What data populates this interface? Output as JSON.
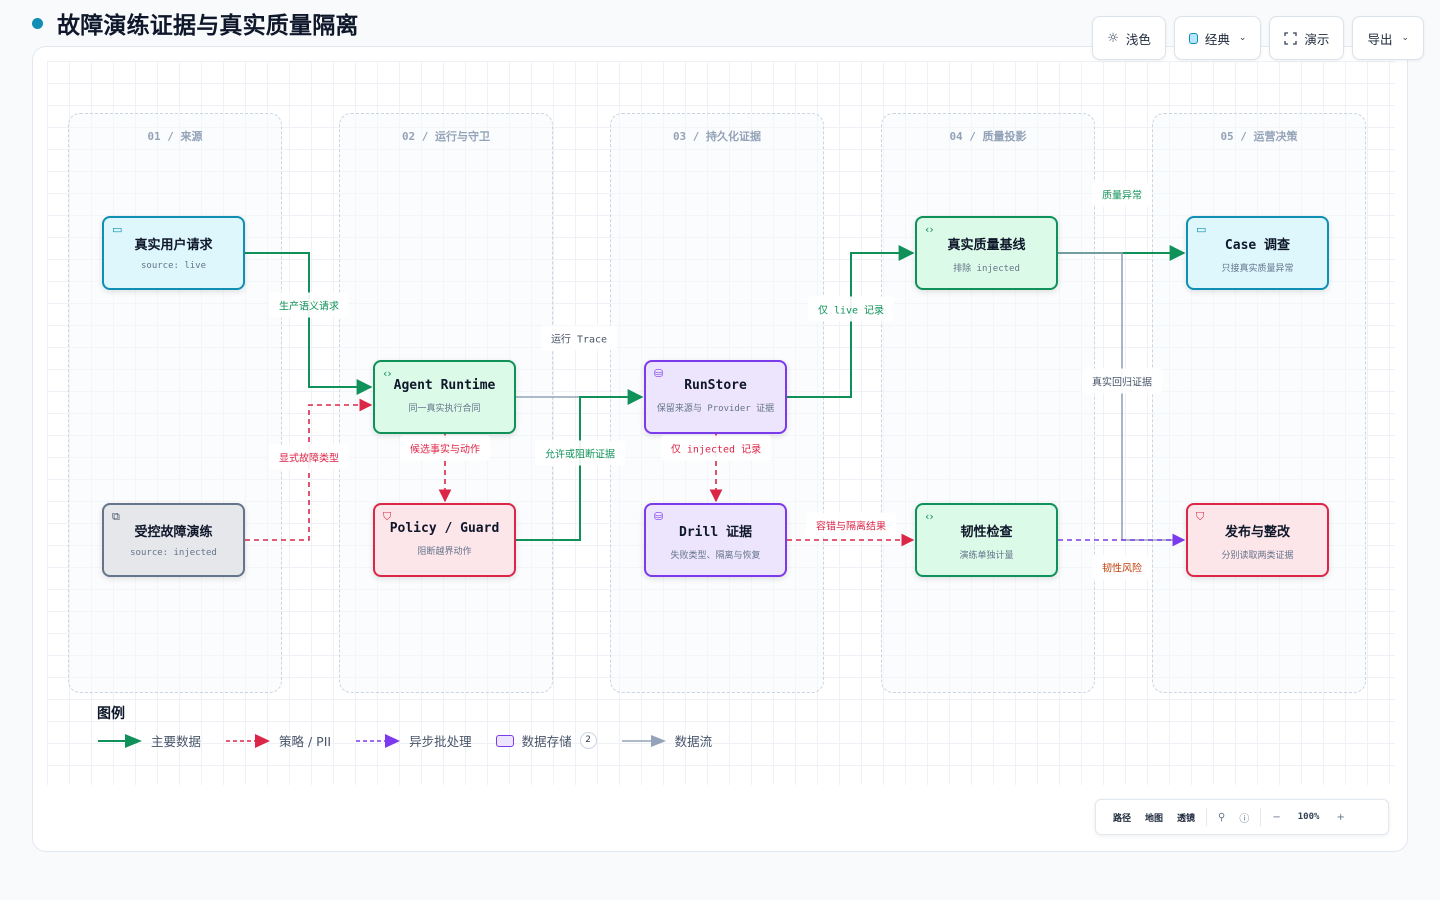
{
  "page": {
    "title": "故障演练证据与真实质量隔离"
  },
  "toolbar": {
    "theme_label": "浅色",
    "style_label": "经典",
    "present_label": "演示",
    "export_label": "导出"
  },
  "lanes": [
    {
      "label": "01 / 来源"
    },
    {
      "label": "02 / 运行与守卫"
    },
    {
      "label": "03 / 持久化证据"
    },
    {
      "label": "04 / 质量投影"
    },
    {
      "label": "05 / 运营决策"
    }
  ],
  "nodes": {
    "real_request": {
      "title": "真实用户请求",
      "sub": "source: live",
      "icon": "window-icon"
    },
    "fault_drill": {
      "title": "受控故障演练",
      "sub": "source: injected",
      "icon": "external-link-icon"
    },
    "agent_runtime": {
      "title": "Agent Runtime",
      "sub": "同一真实执行合同",
      "icon": "code-icon"
    },
    "policy_guard": {
      "title": "Policy / Guard",
      "sub": "阻断越界动作",
      "icon": "shield-icon"
    },
    "runstore": {
      "title": "RunStore",
      "sub": "保留来源与 Provider 证据",
      "icon": "database-icon"
    },
    "drill_evidence": {
      "title": "Drill 证据",
      "sub": "失败类型、隔离与恢复",
      "icon": "database-icon"
    },
    "quality_baseline": {
      "title": "真实质量基线",
      "sub": "排除 injected",
      "icon": "code-icon"
    },
    "resilience_check": {
      "title": "韧性检查",
      "sub": "演练单独计量",
      "icon": "code-icon"
    },
    "case_investigation": {
      "title": "Case 调查",
      "sub": "只接真实质量异常",
      "icon": "window-icon"
    },
    "release_fix": {
      "title": "发布与整改",
      "sub": "分别读取两类证据",
      "icon": "shield-icon"
    }
  },
  "edge_labels": {
    "production_semantic": "生产语义请求",
    "explicit_fault": "显式故障类型",
    "run_trace": "运行 Trace",
    "candidate_fact": "候选事实与动作",
    "allow_block": "允许或阻断证据",
    "live_only": "仅 live 记录",
    "injected_only": "仅 injected 记录",
    "fault_tolerance": "容错与隔离结果",
    "quality_anomaly": "质量异常",
    "real_regression": "真实回归证据",
    "resilience_risk": "韧性风险"
  },
  "legend": {
    "title": "图例",
    "items": {
      "primary_data": "主要数据",
      "policy_pii": "策略 / PII",
      "async_batch": "异步批处理",
      "data_storage": "数据存储",
      "data_flow": "数据流"
    },
    "storage_count": "2"
  },
  "zoombar": {
    "path": "路径",
    "map": "地图",
    "lens": "透镜",
    "search_icon": "search-icon",
    "help_icon": "help-icon",
    "zoom_out": "−",
    "zoom_level": "100%",
    "zoom_in": "+"
  },
  "colors": {
    "primary": "#10915a",
    "policy": "#dc2648",
    "async": "#7c3aed",
    "flow": "#94a3b8",
    "accent": "#0e8fb3"
  }
}
